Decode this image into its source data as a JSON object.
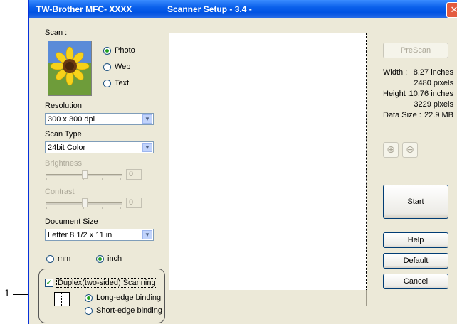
{
  "callout": {
    "number": "1"
  },
  "window": {
    "app_title": "TW-Brother MFC- XXXX",
    "dialog_title": "Scanner Setup - 3.4 -",
    "close_symbol": "✕"
  },
  "scan": {
    "label": "Scan :",
    "options": [
      {
        "label": "Photo",
        "selected": true
      },
      {
        "label": "Web",
        "selected": false
      },
      {
        "label": "Text",
        "selected": false
      }
    ]
  },
  "resolution": {
    "label": "Resolution",
    "value": "300 x 300 dpi"
  },
  "scan_type": {
    "label": "Scan Type",
    "value": "24bit Color"
  },
  "brightness": {
    "label": "Brightness",
    "value": "0",
    "level": 0.5
  },
  "contrast": {
    "label": "Contrast",
    "value": "0",
    "level": 0.5
  },
  "document_size": {
    "label": "Document Size",
    "value": "Letter 8 1/2 x 11 in"
  },
  "units": {
    "mm": "mm",
    "inch": "inch",
    "selected": "inch"
  },
  "duplex": {
    "label": "Duplex(two-sided) Scanning",
    "checked": true,
    "long_edge": "Long-edge binding",
    "short_edge": "Short-edge binding",
    "selected": "long"
  },
  "info": {
    "prescan": "PreScan",
    "width_label": "Width :",
    "width_value": "8.27 inches",
    "width_pixels": "2480 pixels",
    "height_label": "Height :",
    "height_value": "10.76 inches",
    "height_pixels": "3229 pixels",
    "datasize_label": "Data Size :",
    "datasize_value": "22.9 MB"
  },
  "buttons": {
    "start": "Start",
    "help": "Help",
    "default": "Default",
    "cancel": "Cancel"
  },
  "colors": {
    "titlebar": "#0A5FEA",
    "dialog_bg": "#ECE9D8",
    "radio_dot": "#21A121"
  }
}
